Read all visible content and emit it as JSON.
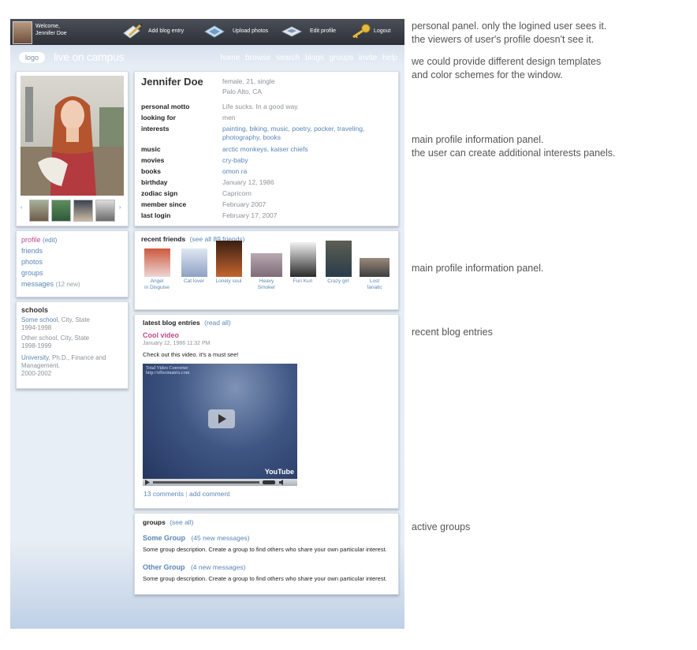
{
  "personal_panel": {
    "welcome_line1": "Welcome,",
    "welcome_line2": "Jennifer Doe",
    "actions": [
      "Add blog entry",
      "Upload photos",
      "Edit profile",
      "Logout"
    ]
  },
  "brand": {
    "logo": "logo",
    "site_name": "live on campus"
  },
  "main_nav": [
    "home",
    "browse",
    "search",
    "blogs",
    "groups",
    "invite",
    "help"
  ],
  "profile": {
    "name": "Jennifer Doe",
    "summary_line1": "female, 21, single",
    "summary_line2": "Palo Alto, CA",
    "fields": [
      {
        "label": "personal motto",
        "value": "Life sucks. In a good way."
      },
      {
        "label": "looking for",
        "value": "men"
      },
      {
        "label": "interests",
        "value": "painting, biking, music, poetry, pocker, traveling, photography, books"
      },
      {
        "label": "music",
        "value": "arctic monkeys, kaiser chiefs"
      },
      {
        "label": "movies",
        "value": "cry-baby"
      },
      {
        "label": "books",
        "value": "omon ra"
      },
      {
        "label": "birthday",
        "value": "January 12, 1986"
      },
      {
        "label": "zodiac sign",
        "value": "Capricorn"
      },
      {
        "label": "member since",
        "value": "February 2007"
      },
      {
        "label": "last login",
        "value": "February 17, 2007"
      }
    ]
  },
  "side_nav": {
    "profile": "profile",
    "edit": "(edit)",
    "friends": "friends",
    "photos": "photos",
    "groups": "groups",
    "messages": "messages",
    "messages_count": "(12 new)"
  },
  "schools": {
    "title": "schools",
    "entries": [
      {
        "name": "Some school",
        "rest": ", City, State",
        "years": "1994-1998"
      },
      {
        "name": "Other  school, City, State",
        "rest": "",
        "years": "1998-1999"
      },
      {
        "name": "University",
        "rest": ", Ph.D., Finance and Management,",
        "years": "2000-2002"
      }
    ]
  },
  "friends": {
    "title": "recent friends",
    "see_all": "(see all 89 friends)",
    "items": [
      {
        "line1": "Angel",
        "line2": "in Disguise"
      },
      {
        "line1": "Cat lover",
        "line2": ""
      },
      {
        "line1": "Lonely soul",
        "line2": ""
      },
      {
        "line1": "Heavy",
        "line2": "Smoker"
      },
      {
        "line1": "Furi Kuri",
        "line2": ""
      },
      {
        "line1": "Crazy girl",
        "line2": ""
      },
      {
        "line1": "Lost",
        "line2": "fanatic"
      }
    ]
  },
  "blog": {
    "title": "latest blog entries",
    "read_all": "(read all)",
    "entry_title": "Cool video",
    "entry_date": "January 12, 1986  11:32 PM",
    "entry_text": "Check out this video. it's a must see!",
    "video_caption_1": "Total Video Converter",
    "video_caption_2": "http://effectmatrix.com",
    "video_brand": "YouTube",
    "comments": "13 comments",
    "separator": "|",
    "add_comment": "add comment"
  },
  "groups": {
    "title": "groups",
    "see_all": "(see all)",
    "items": [
      {
        "name": "Some Group",
        "count": "(45 new messages)",
        "desc": "Some group description. Create a group to find others who share your own particular interest."
      },
      {
        "name": "Other Group",
        "count": "(4 new messages)",
        "desc": "Some group description. Create a group to find others who share your own particular interest."
      }
    ]
  },
  "notes": {
    "personal_1": "personal panel. only the logined user sees it.",
    "personal_2": "the viewers of user's profile doesn't see it.",
    "design_1": "we could provide different design templates",
    "design_2": "and color schemes for the window.",
    "main_1": "main profile information panel.",
    "main_2": "the user can create additional interests panels.",
    "main2_1": "main profile information panel.",
    "blog_1": "recent blog entries",
    "groups_1": "active groups"
  }
}
